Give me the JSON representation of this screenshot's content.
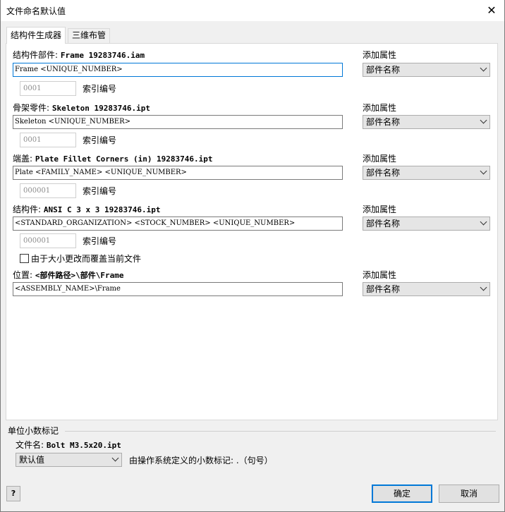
{
  "window": {
    "title": "文件命名默认值",
    "close_label": "✕"
  },
  "tabs": [
    {
      "label": "结构件生成器"
    },
    {
      "label": "三维布管"
    }
  ],
  "rows": [
    {
      "caption": "结构件部件:",
      "filename": "Frame 19283746.iam",
      "pattern": "Frame <UNIQUE_NUMBER>",
      "index_value": "0001",
      "index_label": "索引编号",
      "attr_label": "添加属性",
      "attr_value": "部件名称"
    },
    {
      "caption": "骨架零件:",
      "filename": "Skeleton 19283746.ipt",
      "pattern": "Skeleton <UNIQUE_NUMBER>",
      "index_value": "0001",
      "index_label": "索引编号",
      "attr_label": "添加属性",
      "attr_value": "部件名称"
    },
    {
      "caption": "端盖:",
      "filename": "Plate Fillet Corners (in) 19283746.ipt",
      "pattern": "Plate <FAMILY_NAME> <UNIQUE_NUMBER>",
      "index_value": "000001",
      "index_label": "索引编号",
      "attr_label": "添加属性",
      "attr_value": "部件名称"
    },
    {
      "caption": "结构件:",
      "filename": "ANSI C 3 x 3 19283746.ipt",
      "pattern": "<STANDARD_ORGANIZATION> <STOCK_NUMBER> <UNIQUE_NUMBER>",
      "index_value": "000001",
      "index_label": "索引编号",
      "attr_label": "添加属性",
      "attr_value": "部件名称"
    }
  ],
  "override_checkbox": {
    "label": "由于大小更改而覆盖当前文件",
    "checked": false
  },
  "location": {
    "caption": "位置:",
    "path": "<部件路径>\\部件\\Frame",
    "pattern": "<ASSEMBLY_NAME>\\Frame",
    "attr_label": "添加属性",
    "attr_value": "部件名称"
  },
  "decimal": {
    "section_title": "单位小数标记",
    "filename_caption": "文件名:",
    "filename": "Bolt M3.5x20.ipt",
    "dropdown_value": "默认值",
    "description": "由操作系统定义的小数标记: .（句号）"
  },
  "buttons": {
    "help": "?",
    "ok": "确定",
    "cancel": "取消"
  }
}
